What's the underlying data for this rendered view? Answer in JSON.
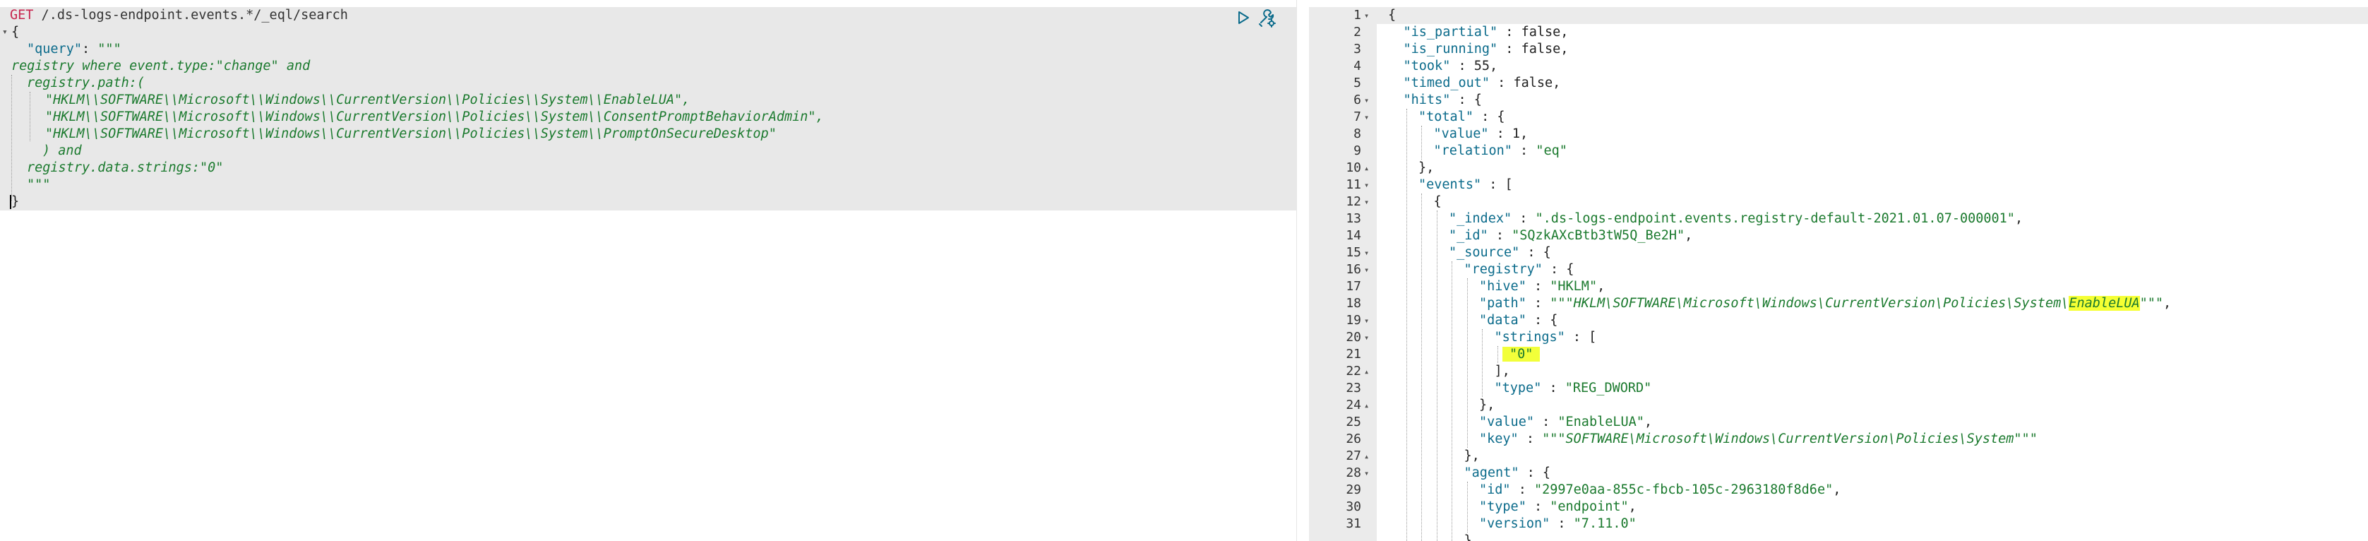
{
  "request": {
    "method": "GET",
    "path": " /.ds-logs-endpoint.events.*/_eql/search",
    "lines": [
      {
        "fold": "",
        "indent": 0,
        "parts": [
          {
            "t": "GET",
            "c": "tk-method"
          },
          {
            "t": " /.ds-logs-endpoint.events.*/_eql/search",
            "c": "tk-path"
          }
        ]
      },
      {
        "fold": "▾",
        "indent": 1,
        "parts": [
          {
            "t": "{",
            "c": "tk-punc"
          }
        ]
      },
      {
        "fold": "",
        "indent": 2,
        "parts": [
          {
            "t": "\"query\"",
            "c": "tk-key"
          },
          {
            "t": ": ",
            "c": "tk-punc"
          },
          {
            "t": "\"\"\"",
            "c": "tk-str"
          }
        ]
      },
      {
        "fold": "",
        "indent": 1,
        "parts": [
          {
            "t": "registry where event.type:\"change\" and",
            "c": "tk-eql"
          }
        ]
      },
      {
        "fold": "",
        "indent": 2,
        "parts": [
          {
            "t": "registry.path:(",
            "c": "tk-eql"
          }
        ]
      },
      {
        "fold": "",
        "indent": 3,
        "parts": [
          {
            "t": "\"HKLM\\\\SOFTWARE\\\\Microsoft\\\\Windows\\\\CurrentVersion\\\\Policies\\\\System\\\\EnableLUA\",",
            "c": "tk-eql"
          }
        ]
      },
      {
        "fold": "",
        "indent": 3,
        "parts": [
          {
            "t": "\"HKLM\\\\SOFTWARE\\\\Microsoft\\\\Windows\\\\CurrentVersion\\\\Policies\\\\System\\\\ConsentPromptBehaviorAdmin\",",
            "c": "tk-eql"
          }
        ]
      },
      {
        "fold": "",
        "indent": 3,
        "parts": [
          {
            "t": "\"HKLM\\\\SOFTWARE\\\\Microsoft\\\\Windows\\\\CurrentVersion\\\\Policies\\\\System\\\\PromptOnSecureDesktop\"",
            "c": "tk-eql"
          }
        ]
      },
      {
        "fold": "",
        "indent": 4,
        "parts": [
          {
            "t": ") and",
            "c": "tk-eql"
          }
        ]
      },
      {
        "fold": "",
        "indent": 2,
        "parts": [
          {
            "t": "registry.data.strings:\"0\"",
            "c": "tk-eql"
          }
        ]
      },
      {
        "fold": "",
        "indent": 2,
        "parts": [
          {
            "t": "\"\"\"",
            "c": "tk-str"
          }
        ]
      },
      {
        "fold": "",
        "indent": 1,
        "parts": [
          {
            "t": "}",
            "c": "tk-punc"
          }
        ],
        "cursor": true
      }
    ]
  },
  "toolbar": {
    "run_icon": "play-icon",
    "settings_icon": "wrench-icon"
  },
  "response": {
    "lines": [
      {
        "n": "1",
        "fold": "▾",
        "col": 0,
        "parts": [
          {
            "t": "{",
            "c": "tk-punc"
          }
        ]
      },
      {
        "n": "2",
        "fold": "",
        "col": 1,
        "parts": [
          {
            "t": "\"is_partial\"",
            "c": "tk-key"
          },
          {
            "t": " : false,",
            "c": "tk-punc"
          }
        ]
      },
      {
        "n": "3",
        "fold": "",
        "col": 1,
        "parts": [
          {
            "t": "\"is_running\"",
            "c": "tk-key"
          },
          {
            "t": " : false,",
            "c": "tk-punc"
          }
        ]
      },
      {
        "n": "4",
        "fold": "",
        "col": 1,
        "parts": [
          {
            "t": "\"took\"",
            "c": "tk-key"
          },
          {
            "t": " : 55,",
            "c": "tk-punc"
          }
        ]
      },
      {
        "n": "5",
        "fold": "",
        "col": 1,
        "parts": [
          {
            "t": "\"timed_out\"",
            "c": "tk-key"
          },
          {
            "t": " : false,",
            "c": "tk-punc"
          }
        ]
      },
      {
        "n": "6",
        "fold": "▾",
        "col": 1,
        "parts": [
          {
            "t": "\"hits\"",
            "c": "tk-key"
          },
          {
            "t": " : {",
            "c": "tk-punc"
          }
        ]
      },
      {
        "n": "7",
        "fold": "▾",
        "col": 2,
        "parts": [
          {
            "t": "\"total\"",
            "c": "tk-key"
          },
          {
            "t": " : {",
            "c": "tk-punc"
          }
        ]
      },
      {
        "n": "8",
        "fold": "",
        "col": 3,
        "parts": [
          {
            "t": "\"value\"",
            "c": "tk-key"
          },
          {
            "t": " : 1,",
            "c": "tk-punc"
          }
        ]
      },
      {
        "n": "9",
        "fold": "",
        "col": 3,
        "parts": [
          {
            "t": "\"relation\"",
            "c": "tk-key"
          },
          {
            "t": " : ",
            "c": "tk-punc"
          },
          {
            "t": "\"eq\"",
            "c": "tk-str"
          }
        ]
      },
      {
        "n": "10",
        "fold": "▴",
        "col": 2,
        "parts": [
          {
            "t": "},",
            "c": "tk-punc"
          }
        ]
      },
      {
        "n": "11",
        "fold": "▾",
        "col": 2,
        "parts": [
          {
            "t": "\"events\"",
            "c": "tk-key"
          },
          {
            "t": " : [",
            "c": "tk-punc"
          }
        ]
      },
      {
        "n": "12",
        "fold": "▾",
        "col": 3,
        "parts": [
          {
            "t": "{",
            "c": "tk-punc"
          }
        ]
      },
      {
        "n": "13",
        "fold": "",
        "col": 4,
        "parts": [
          {
            "t": "\"_index\"",
            "c": "tk-key"
          },
          {
            "t": " : ",
            "c": "tk-punc"
          },
          {
            "t": "\".ds-logs-endpoint.events.registry-default-2021.01.07-000001\"",
            "c": "tk-str"
          },
          {
            "t": ",",
            "c": "tk-punc"
          }
        ]
      },
      {
        "n": "14",
        "fold": "",
        "col": 4,
        "parts": [
          {
            "t": "\"_id\"",
            "c": "tk-key"
          },
          {
            "t": " : ",
            "c": "tk-punc"
          },
          {
            "t": "\"SQzkAXcBtb3tW5Q_Be2H\"",
            "c": "tk-str"
          },
          {
            "t": ",",
            "c": "tk-punc"
          }
        ]
      },
      {
        "n": "15",
        "fold": "▾",
        "col": 4,
        "parts": [
          {
            "t": "\"_source\"",
            "c": "tk-key"
          },
          {
            "t": " : {",
            "c": "tk-punc"
          }
        ]
      },
      {
        "n": "16",
        "fold": "▾",
        "col": 5,
        "parts": [
          {
            "t": "\"registry\"",
            "c": "tk-key"
          },
          {
            "t": " : {",
            "c": "tk-punc"
          }
        ]
      },
      {
        "n": "17",
        "fold": "",
        "col": 6,
        "parts": [
          {
            "t": "\"hive\"",
            "c": "tk-key"
          },
          {
            "t": " : ",
            "c": "tk-punc"
          },
          {
            "t": "\"HKLM\"",
            "c": "tk-str"
          },
          {
            "t": ",",
            "c": "tk-punc"
          }
        ]
      },
      {
        "n": "18",
        "fold": "",
        "col": 6,
        "parts": [
          {
            "t": "\"path\"",
            "c": "tk-key"
          },
          {
            "t": " : ",
            "c": "tk-punc"
          },
          {
            "t": "\"\"\"",
            "c": "tk-str"
          },
          {
            "t": "HKLM\\SOFTWARE\\Microsoft\\Windows\\CurrentVersion\\Policies\\System\\",
            "c": "tk-eql"
          },
          {
            "t": "EnableLUA",
            "c": "tk-eql hl"
          },
          {
            "t": "\"\"\"",
            "c": "tk-str"
          },
          {
            "t": ",",
            "c": "tk-punc"
          }
        ]
      },
      {
        "n": "19",
        "fold": "▾",
        "col": 6,
        "parts": [
          {
            "t": "\"data\"",
            "c": "tk-key"
          },
          {
            "t": " : {",
            "c": "tk-punc"
          }
        ]
      },
      {
        "n": "20",
        "fold": "▾",
        "col": 7,
        "parts": [
          {
            "t": "\"strings\"",
            "c": "tk-key"
          },
          {
            "t": " : [",
            "c": "tk-punc"
          }
        ]
      },
      {
        "n": "21",
        "fold": "",
        "col": 8,
        "parts": [
          {
            "t": "\"0\"",
            "c": "tk-str hl-val"
          }
        ]
      },
      {
        "n": "22",
        "fold": "▴",
        "col": 7,
        "parts": [
          {
            "t": "],",
            "c": "tk-punc"
          }
        ]
      },
      {
        "n": "23",
        "fold": "",
        "col": 7,
        "parts": [
          {
            "t": "\"type\"",
            "c": "tk-key"
          },
          {
            "t": " : ",
            "c": "tk-punc"
          },
          {
            "t": "\"REG_DWORD\"",
            "c": "tk-str"
          }
        ]
      },
      {
        "n": "24",
        "fold": "▴",
        "col": 6,
        "parts": [
          {
            "t": "},",
            "c": "tk-punc"
          }
        ]
      },
      {
        "n": "25",
        "fold": "",
        "col": 6,
        "parts": [
          {
            "t": "\"value\"",
            "c": "tk-key"
          },
          {
            "t": " : ",
            "c": "tk-punc"
          },
          {
            "t": "\"EnableLUA\"",
            "c": "tk-str"
          },
          {
            "t": ",",
            "c": "tk-punc"
          }
        ]
      },
      {
        "n": "26",
        "fold": "",
        "col": 6,
        "parts": [
          {
            "t": "\"key\"",
            "c": "tk-key"
          },
          {
            "t": " : ",
            "c": "tk-punc"
          },
          {
            "t": "\"\"\"",
            "c": "tk-str"
          },
          {
            "t": "SOFTWARE\\Microsoft\\Windows\\CurrentVersion\\Policies\\System",
            "c": "tk-eql"
          },
          {
            "t": "\"\"\"",
            "c": "tk-str"
          }
        ]
      },
      {
        "n": "27",
        "fold": "▴",
        "col": 5,
        "parts": [
          {
            "t": "},",
            "c": "tk-punc"
          }
        ]
      },
      {
        "n": "28",
        "fold": "▾",
        "col": 5,
        "parts": [
          {
            "t": "\"agent\"",
            "c": "tk-key"
          },
          {
            "t": " : {",
            "c": "tk-punc"
          }
        ]
      },
      {
        "n": "29",
        "fold": "",
        "col": 6,
        "parts": [
          {
            "t": "\"id\"",
            "c": "tk-key"
          },
          {
            "t": " : ",
            "c": "tk-punc"
          },
          {
            "t": "\"2997e0aa-855c-fbcb-105c-2963180f8d6e\"",
            "c": "tk-str"
          },
          {
            "t": ",",
            "c": "tk-punc"
          }
        ]
      },
      {
        "n": "30",
        "fold": "",
        "col": 6,
        "parts": [
          {
            "t": "\"type\"",
            "c": "tk-key"
          },
          {
            "t": " : ",
            "c": "tk-punc"
          },
          {
            "t": "\"endpoint\"",
            "c": "tk-str"
          },
          {
            "t": ",",
            "c": "tk-punc"
          }
        ]
      },
      {
        "n": "31",
        "fold": "",
        "col": 6,
        "parts": [
          {
            "t": "\"version\"",
            "c": "tk-key"
          },
          {
            "t": " : ",
            "c": "tk-punc"
          },
          {
            "t": "\"7.11.0\"",
            "c": "tk-str"
          }
        ]
      },
      {
        "n": "",
        "fold": "",
        "col": 5,
        "parts": [
          {
            "t": "}",
            "c": "tk-punc"
          }
        ]
      }
    ]
  },
  "colors": {
    "method": "#c7254e",
    "key": "#0b6b8b",
    "string": "#1b7a2e",
    "highlight": "#f5ff33",
    "request_bg": "#e8e8e8",
    "gutter_bg": "#ebebeb"
  }
}
